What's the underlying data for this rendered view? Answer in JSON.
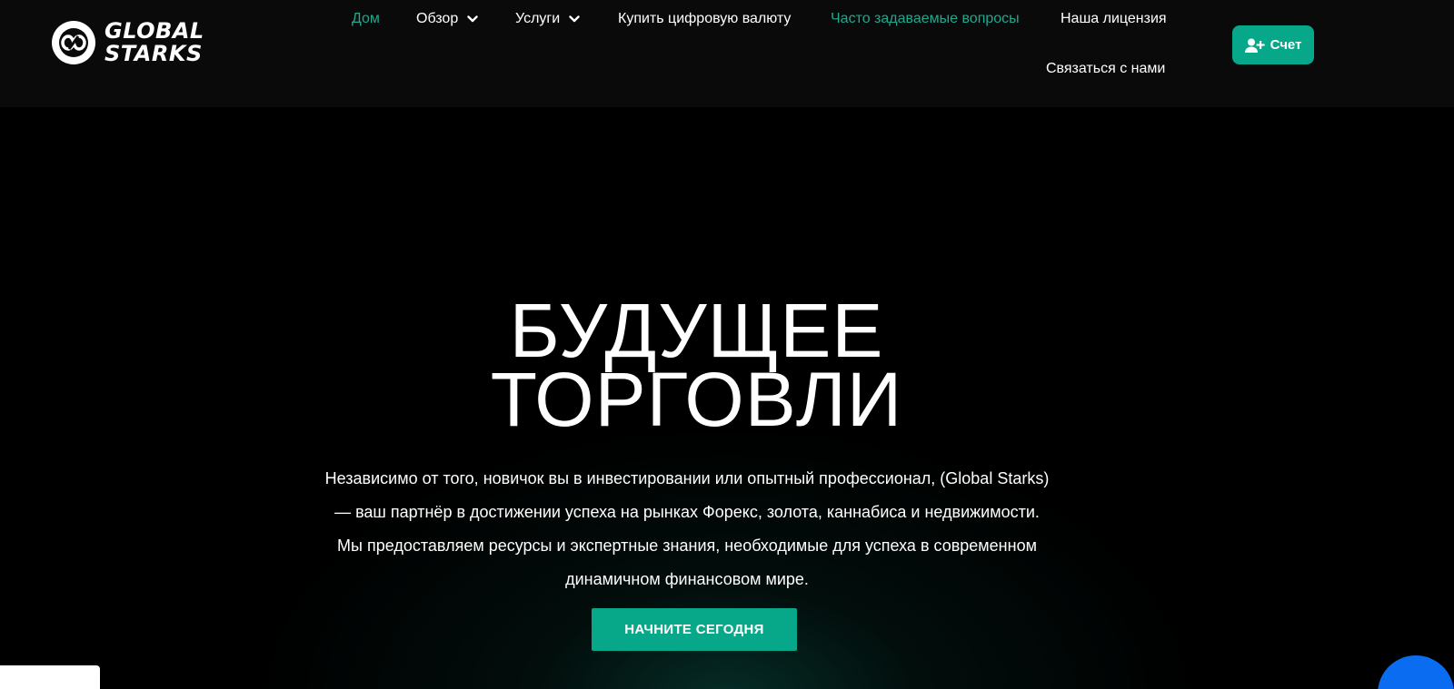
{
  "brand": {
    "line1": "GLOBAL",
    "line2": "STARKS",
    "logo_icon": "infinity-link-icon"
  },
  "nav": {
    "home": "Дом",
    "overview": "Обзор",
    "services": "Услуги",
    "buy_crypto": "Купить цифровую валюту",
    "faq": "Часто задаваемые вопросы",
    "license": "Наша лицензия",
    "contact": "Связаться с нами"
  },
  "account_button": {
    "label": "Счет",
    "icon": "user-plus-icon"
  },
  "hero": {
    "title_line1": "БУДУЩЕЕ",
    "title_line2": "ТОРГОВЛИ",
    "text_line1": "Независимо от того, новичок вы в инвестировании или опытный профессионал, (Global Starks)",
    "text_line2": "— ваш партнёр в достижении успеха на рынках Форекс, золота, каннабиса и недвижимости.",
    "text_line3": "Мы предоставляем ресурсы и экспертные знания, необходимые для успеха в современном",
    "text_line4": "динамичном финансовом мире.",
    "cta": "НАЧНИТЕ СЕГОДНЯ"
  },
  "colors": {
    "accent": "#07a88a",
    "active_link": "#1fa98f",
    "header_bg": "#0a0a0a",
    "page_bg": "#000000",
    "chat_widget": "#0a6cf0"
  }
}
